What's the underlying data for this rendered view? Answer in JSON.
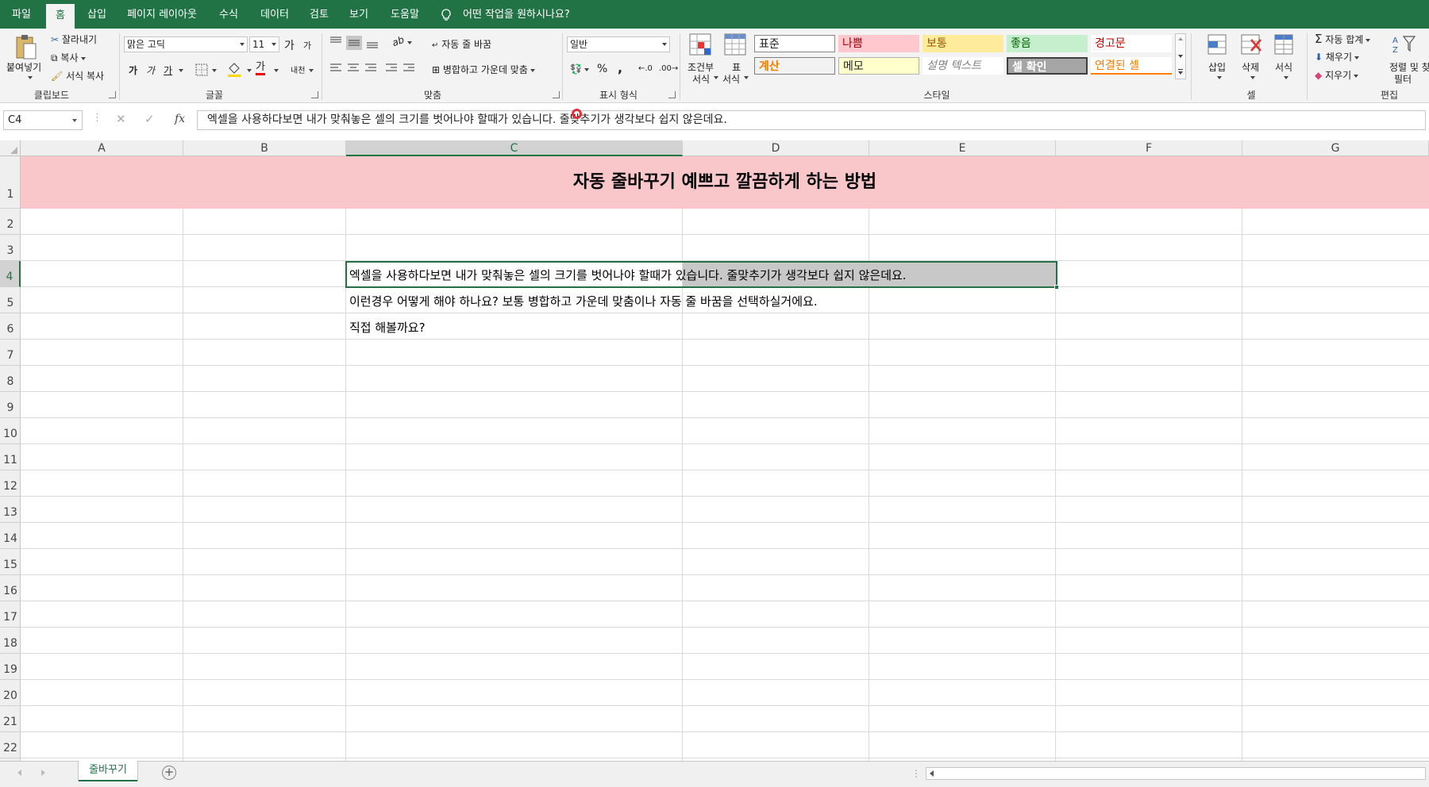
{
  "menu": {
    "tabs": [
      {
        "label": "파일"
      },
      {
        "label": "홈"
      },
      {
        "label": "삽입"
      },
      {
        "label": "페이지 레이아웃"
      },
      {
        "label": "수식"
      },
      {
        "label": "데이터"
      },
      {
        "label": "검토"
      },
      {
        "label": "보기"
      },
      {
        "label": "도움말"
      }
    ],
    "active_tab": "홈",
    "tell_me": "어떤 작업을 원하시나요?"
  },
  "ribbon": {
    "clipboard": {
      "paste": "붙여넣기",
      "cut": "잘라내기",
      "copy": "복사",
      "format_painter": "서식 복사",
      "label": "클립보드"
    },
    "font": {
      "name": "맑은 고딕",
      "size": "11",
      "label": "글꼴",
      "grow": "가",
      "shrink": "가",
      "bold": "가",
      "italic": "가",
      "underline": "가",
      "font_color": "가",
      "phonetic": "내천"
    },
    "alignment": {
      "wrap_text": "자동 줄 바꿈",
      "merge_center": "병합하고 가운데 맞춤",
      "label": "맞춤",
      "orientation": "ab"
    },
    "number": {
      "format": "일반",
      "label": "표시 형식",
      "percent": "%",
      "comma": ","
    },
    "styles": {
      "conditional": "조건부\n서식",
      "conditional_l1": "조건부",
      "conditional_l2": "서식",
      "table_l1": "표",
      "table_l2": "서식",
      "label": "스타일",
      "cells": [
        {
          "label": "표준"
        },
        {
          "label": "나쁨"
        },
        {
          "label": "보통"
        },
        {
          "label": "좋음"
        },
        {
          "label": "경고문"
        },
        {
          "label": "계산"
        },
        {
          "label": "메모"
        },
        {
          "label": "설명 텍스트"
        },
        {
          "label": "셀 확인"
        },
        {
          "label": "연결된 셀"
        }
      ]
    },
    "cells_group": {
      "insert": "삽입",
      "delete": "삭제",
      "format": "서식",
      "label": "셀"
    },
    "editing": {
      "autosum": "자동 합계",
      "fill": "채우기",
      "clear": "지우기",
      "sort_l1": "정렬 및 찾",
      "sort_l2": "필터",
      "label": "편집"
    }
  },
  "formula_bar": {
    "name_box": "C4",
    "fx": "fx",
    "value": "엑셀을 사용하다보면 내가 맞춰놓은 셀의 크기를 벗어나야 할때가 있습니다. 줄맞추기가 생각보다 쉽지 않은데요."
  },
  "grid": {
    "columns": [
      "A",
      "B",
      "C",
      "D",
      "E",
      "F",
      "G"
    ],
    "selected_column": "C",
    "rows": [
      "1",
      "2",
      "3",
      "4",
      "5",
      "6",
      "7",
      "8",
      "9",
      "10",
      "11",
      "12",
      "13",
      "14",
      "15",
      "16",
      "17",
      "18",
      "19",
      "20",
      "21",
      "22"
    ],
    "selected_row": "4",
    "title": "자동 줄바꾸기 예쁘고 깔끔하게 하는 방법",
    "c4": "엑셀을 사용하다보면 내가 맞춰놓은 셀의 크기를 벗어나야 할때가 있습니다. 줄맞추기가 생각보다 쉽지 않은데요.",
    "c5": "이런경우 어떻게 해야 하나요? 보통 병합하고 가운데 맞춤이나 자동 줄 바꿈을 선택하실거에요.",
    "c6": "직접 해볼까요?"
  },
  "sheet_tabs": {
    "active": "줄바꾸기"
  },
  "colors": {
    "excel_green": "#217346",
    "title_band": "#f9c6ca",
    "selection_fill": "#c8c8c8"
  }
}
